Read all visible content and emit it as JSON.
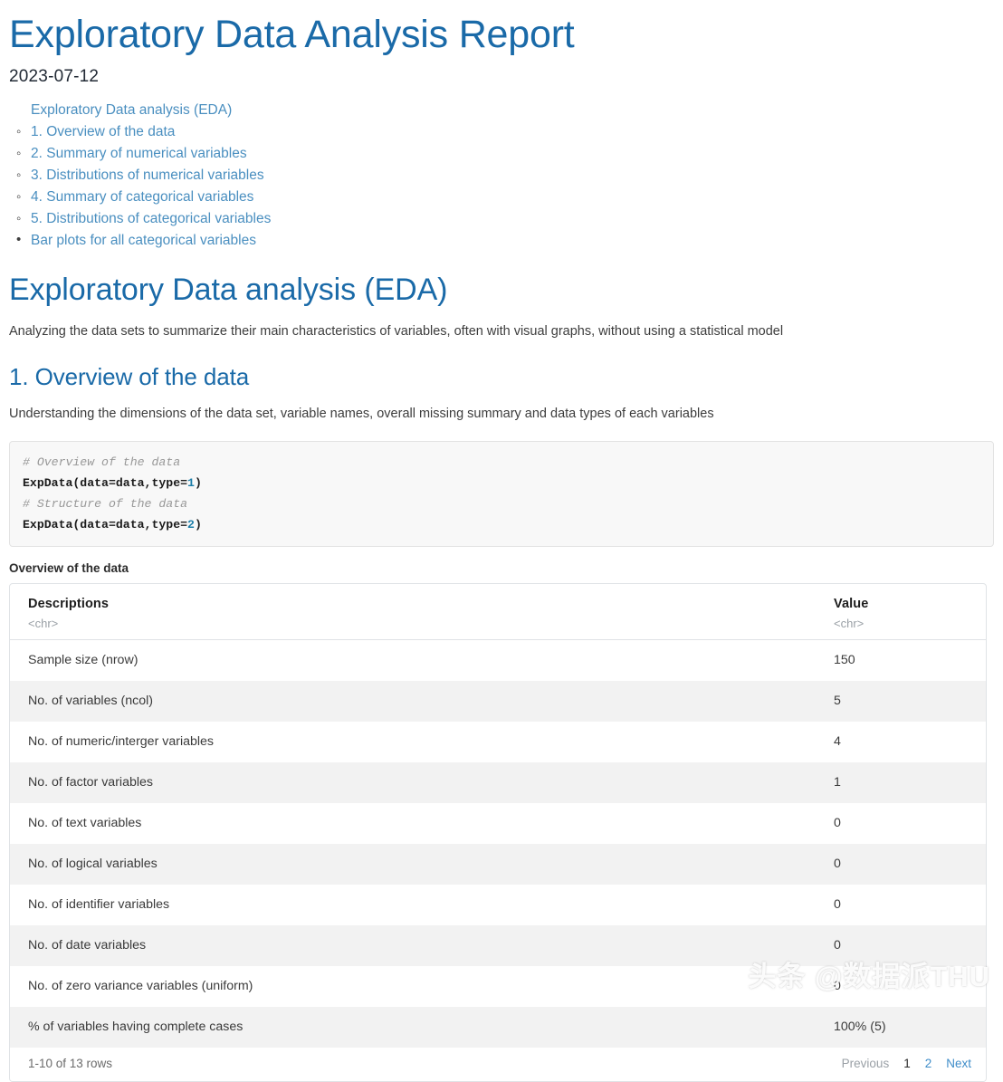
{
  "document": {
    "title": "Exploratory Data Analysis Report",
    "date": "2023-07-12"
  },
  "toc": {
    "root": {
      "label": "Exploratory Data analysis (EDA)"
    },
    "items": [
      {
        "label": "1. Overview of the data"
      },
      {
        "label": "2. Summary of numerical variables"
      },
      {
        "label": "3. Distributions of numerical variables"
      },
      {
        "label": "4. Summary of categorical variables"
      },
      {
        "label": "5. Distributions of categorical variables"
      }
    ],
    "sub_items": [
      {
        "label": "Bar plots for all categorical variables"
      }
    ]
  },
  "sections": {
    "eda": {
      "heading": "Exploratory Data analysis (EDA)",
      "paragraph": "Analyzing the data sets to summarize their main characteristics of variables, often with visual graphs, without using a statistical model"
    },
    "overview": {
      "heading": "1. Overview of the data",
      "paragraph": "Understanding the dimensions of the data set, variable names, overall missing summary and data types of each variables"
    }
  },
  "code_block": {
    "lines": [
      {
        "type": "comment",
        "text": "# Overview of the data"
      },
      {
        "type": "call",
        "fn": "ExpData(data=data,type=",
        "num": "1",
        "close": ")"
      },
      {
        "type": "comment",
        "text": "# Structure of the data"
      },
      {
        "type": "call",
        "fn": "ExpData(data=data,type=",
        "num": "2",
        "close": ")"
      }
    ]
  },
  "table": {
    "caption": "Overview of the data",
    "columns": [
      {
        "label": "Descriptions",
        "type": "<chr>"
      },
      {
        "label": "Value",
        "type": "<chr>"
      }
    ],
    "rows": [
      {
        "description": "Sample size (nrow)",
        "value": "150"
      },
      {
        "description": "No. of variables (ncol)",
        "value": "5"
      },
      {
        "description": "No. of numeric/interger variables",
        "value": "4"
      },
      {
        "description": "No. of factor variables",
        "value": "1"
      },
      {
        "description": "No. of text variables",
        "value": "0"
      },
      {
        "description": "No. of logical variables",
        "value": "0"
      },
      {
        "description": "No. of identifier variables",
        "value": "0"
      },
      {
        "description": "No. of date variables",
        "value": "0"
      },
      {
        "description": "No. of zero variance variables (uniform)",
        "value": "0"
      },
      {
        "description": "% of variables having complete cases",
        "value": "100% (5)"
      }
    ],
    "pagination": {
      "info": "1-10 of 13 rows",
      "previous": "Previous",
      "page_current": "1",
      "page_next": "2",
      "next": "Next"
    }
  },
  "watermark": {
    "text": "头条 @数据派THU"
  },
  "colors": {
    "heading_blue": "#1a6aa8",
    "link_blue": "#4a8fc0",
    "pagination_link": "#3f8dc9",
    "row_stripe": "#f2f2f2",
    "code_bg": "#f8f8f8"
  }
}
